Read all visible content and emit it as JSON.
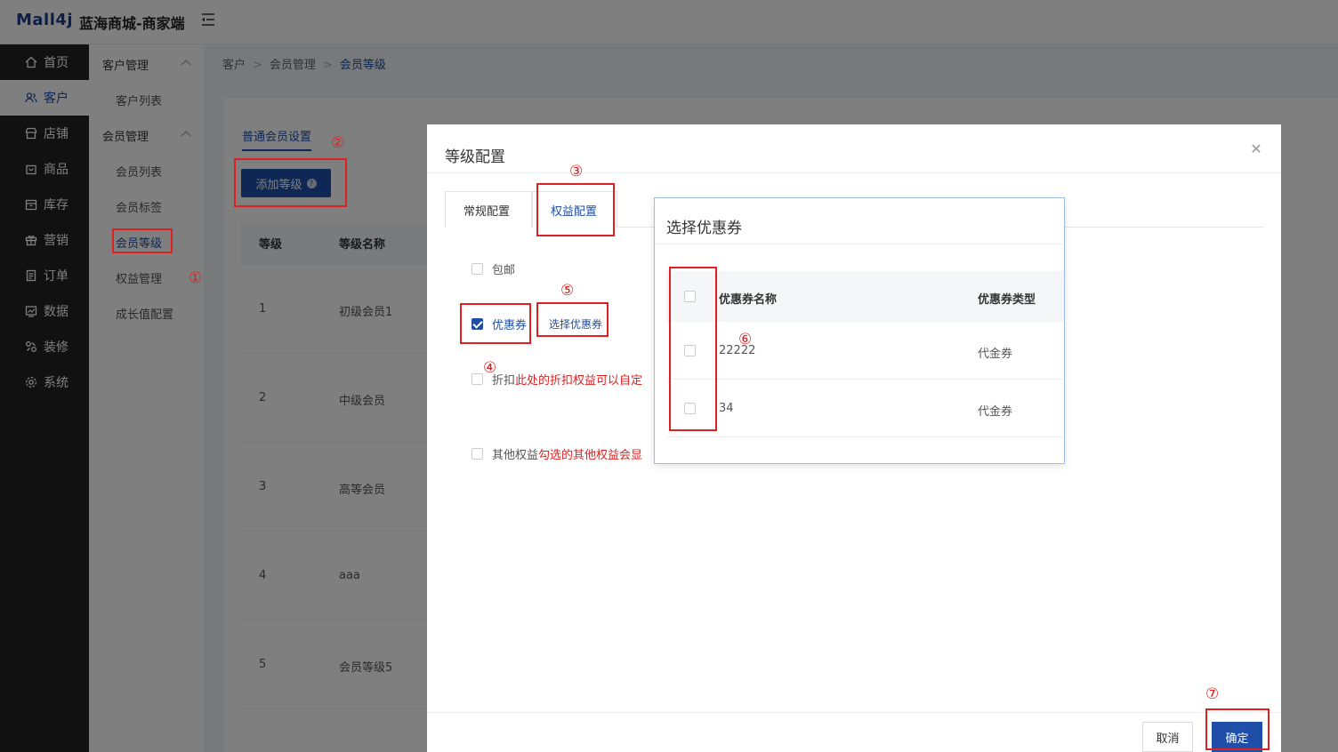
{
  "header": {
    "logo": "Mall4j",
    "title": "蓝海商城-商家端"
  },
  "sidebar": {
    "items": [
      {
        "label": "首页"
      },
      {
        "label": "客户"
      },
      {
        "label": "店铺"
      },
      {
        "label": "商品"
      },
      {
        "label": "库存"
      },
      {
        "label": "营销"
      },
      {
        "label": "订单"
      },
      {
        "label": "数据"
      },
      {
        "label": "装修"
      },
      {
        "label": "系统"
      }
    ]
  },
  "subnav": {
    "group1": "客户管理",
    "group1_items": [
      "客户列表"
    ],
    "group2": "会员管理",
    "group2_items": [
      "会员列表",
      "会员标签",
      "会员等级",
      "权益管理",
      "成长值配置"
    ]
  },
  "breadcrumb": [
    "客户",
    "会员管理",
    "会员等级"
  ],
  "content": {
    "tab": "普通会员设置",
    "add_button": "添加等级",
    "columns": [
      "等级",
      "等级名称"
    ],
    "rows": [
      {
        "level": "1",
        "name": "初级会员1"
      },
      {
        "level": "2",
        "name": "中级会员"
      },
      {
        "level": "3",
        "name": "高等会员"
      },
      {
        "level": "4",
        "name": "aaa"
      },
      {
        "level": "5",
        "name": "会员等级5"
      }
    ]
  },
  "dialog": {
    "title": "等级配置",
    "tabs": [
      "常规配置",
      "权益配置"
    ],
    "benefits": {
      "free_shipping": "包邮",
      "coupon": "优惠券",
      "select_coupon": "选择优惠券",
      "discount": "折扣",
      "discount_note": "此处的折扣权益可以自定",
      "other": "其他权益",
      "other_note": "勾选的其他权益会显"
    },
    "cancel": "取消",
    "confirm": "确定"
  },
  "coupon_popover": {
    "title": "选择优惠券",
    "columns": [
      "优惠券名称",
      "优惠券类型"
    ],
    "rows": [
      {
        "name": "22222",
        "type": "代金券"
      },
      {
        "name": "34",
        "type": "代金券"
      }
    ]
  },
  "annotations": [
    "①",
    "②",
    "③",
    "④",
    "⑤",
    "⑥",
    "⑦"
  ],
  "colors": {
    "accent": "#1e4ea8",
    "annotation": "#e02020",
    "sidebar": "#222222"
  }
}
